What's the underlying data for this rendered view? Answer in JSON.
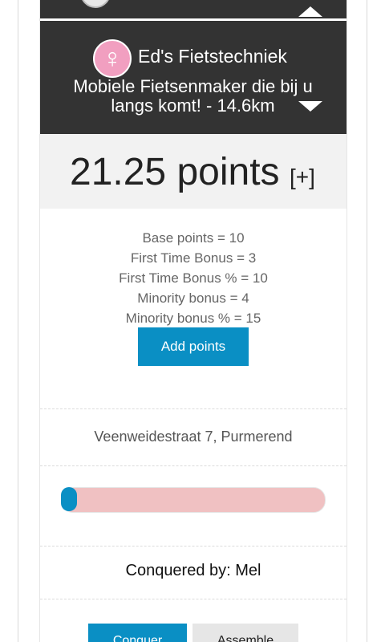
{
  "shop": {
    "name": "Ed's Fietstechniek",
    "description": "Mobiele Fietsenmaker die bij u langs komt! - 14.6km",
    "icon": "venus-icon"
  },
  "points": {
    "total": "21.25 points",
    "toggle": "[+]",
    "breakdown": [
      "Base points = 10",
      "First Time Bonus = 3",
      "First Time Bonus % = 10",
      "Minority bonus = 4",
      "Minority bonus % = 15"
    ],
    "add_label": "Add points"
  },
  "address": "Veenweidestraat 7, Purmerend",
  "progress": {
    "fraction": 0.06,
    "fill_color": "#0a8fc4",
    "track_color": "#f0c1c2"
  },
  "conquered": "Conquered by: Mel",
  "actions": {
    "conquer_label": "Conquer",
    "assemble_label": "Assemble"
  },
  "colors": {
    "header_bg": "#333333",
    "accent": "#0a8fc4",
    "avatar": "#f19fc0"
  }
}
